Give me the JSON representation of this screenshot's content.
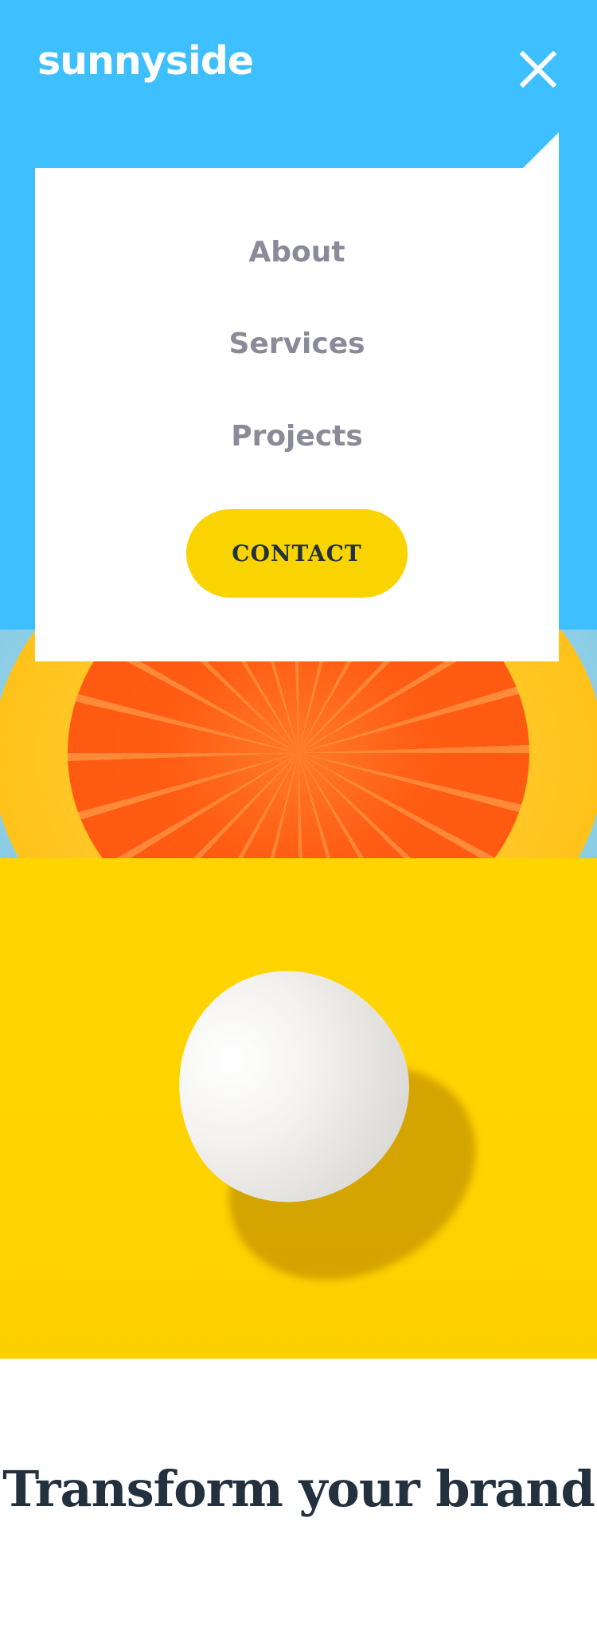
{
  "header": {
    "logo_text": "sunnyside",
    "close_icon": "close-icon"
  },
  "menu": {
    "items": [
      {
        "label": "About"
      },
      {
        "label": "Services"
      },
      {
        "label": "Projects"
      }
    ],
    "contact_label": "CONTACT"
  },
  "main": {
    "heading": "Transform your brand"
  },
  "colors": {
    "hero_blue": "#3ebfff",
    "menu_text": "#8b8a99",
    "contact_yellow": "#fad400",
    "heading_navy": "#23303e",
    "egg_background": "#ffd500"
  }
}
